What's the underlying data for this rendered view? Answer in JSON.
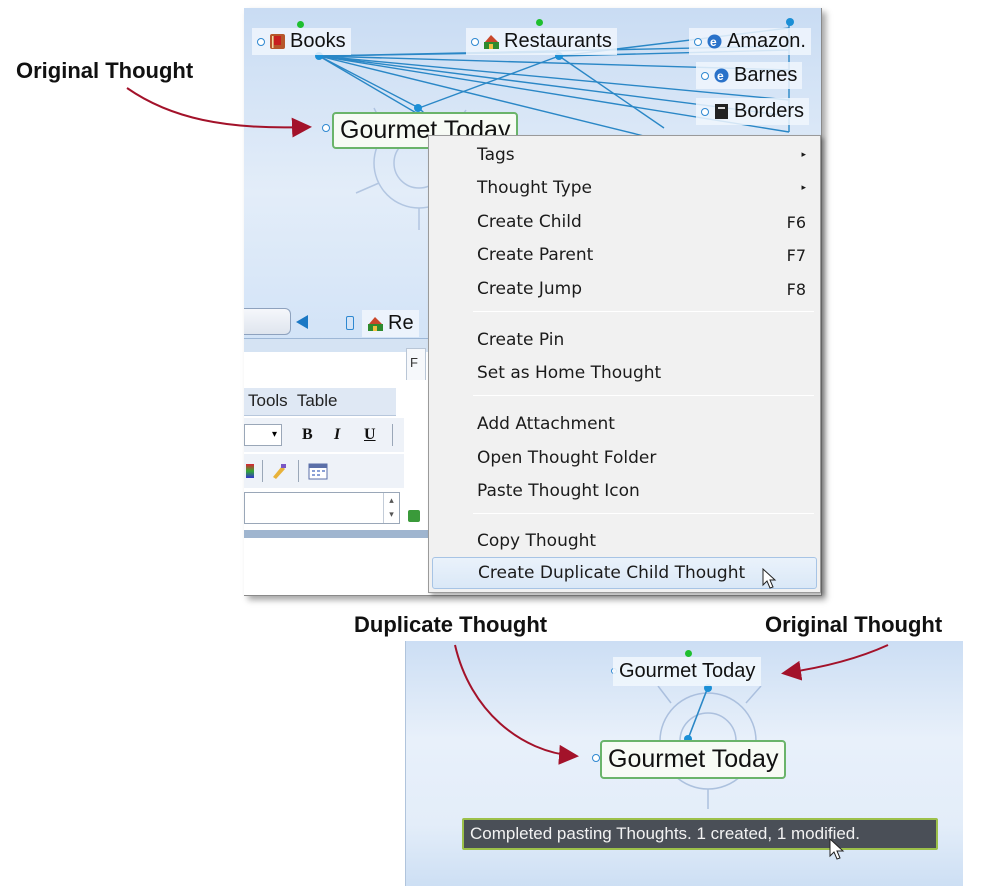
{
  "annotations": {
    "original_thought_top": "Original Thought",
    "duplicate_thought": "Duplicate Thought",
    "original_thought_bottom": "Original Thought"
  },
  "plex_top": {
    "nodes": {
      "books": "Books",
      "restaurants": "Restaurants",
      "amazon": "Amazon.",
      "barnes": "Barnes",
      "borders": "Borders",
      "active": "Gourmet Today",
      "restaurants_partial": "Re"
    },
    "menubar": {
      "tools": "Tools",
      "table": "Table"
    },
    "format_buttons": {
      "bold": "B",
      "italic": "I",
      "underline": "U"
    },
    "tab_partial": "F"
  },
  "context_menu": {
    "items": [
      {
        "label": "Tags",
        "shortcut": "",
        "submenu": true
      },
      {
        "label": "Thought Type",
        "shortcut": "",
        "submenu": true
      },
      {
        "label": "Create Child",
        "shortcut": "F6",
        "submenu": false
      },
      {
        "label": "Create Parent",
        "shortcut": "F7",
        "submenu": false
      },
      {
        "label": "Create Jump",
        "shortcut": "F8",
        "submenu": false
      },
      {
        "label": "Create Pin",
        "shortcut": "",
        "submenu": false
      },
      {
        "label": "Set as Home Thought",
        "shortcut": "",
        "submenu": false
      },
      {
        "label": "Add Attachment",
        "shortcut": "",
        "submenu": false
      },
      {
        "label": "Open Thought Folder",
        "shortcut": "",
        "submenu": false
      },
      {
        "label": "Paste Thought Icon",
        "shortcut": "",
        "submenu": false
      },
      {
        "label": "Copy Thought",
        "shortcut": "",
        "submenu": false
      },
      {
        "label": "Create Duplicate Child Thought",
        "shortcut": "",
        "submenu": false,
        "highlighted": true
      }
    ],
    "submenu_glyph": "▸"
  },
  "plex_bottom": {
    "original": "Gourmet Today",
    "duplicate": "Gourmet Today",
    "status_message": "Completed pasting Thoughts. 1 created, 1 modified."
  },
  "colors": {
    "arrow": "#a3122a",
    "link_line": "#2a87c6",
    "active_border": "#6ab46a",
    "menu_highlight": "#dae8f7"
  }
}
